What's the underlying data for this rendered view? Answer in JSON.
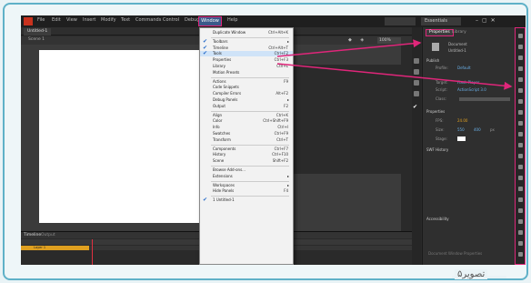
{
  "caption": "تصویر۵",
  "menubar": {
    "items": [
      "File",
      "Edit",
      "View",
      "Insert",
      "Modify",
      "Text",
      "Commands",
      "Control",
      "Debug",
      "Window",
      "Help"
    ],
    "window_label": "Window",
    "workspace": "Essentials"
  },
  "document": {
    "tab": "Untitled-1",
    "scene": "Scene 1",
    "zoom": "100%"
  },
  "properties": {
    "tab_label": "Properties",
    "tab2_label": "Library",
    "doc_type": "Document",
    "doc_name": "Untitled-1",
    "section_publish": "Publish",
    "profile_label": "Profile:",
    "profile_value": "Default",
    "target_label": "Target:",
    "target_value": "Flash Player",
    "script_label": "Script:",
    "script_value": "ActionScript 3.0",
    "class_label": "Class:",
    "section_properties": "Properties",
    "fps_label": "FPS:",
    "fps_value": "24.00",
    "size_label": "Size:",
    "size_w": "550",
    "size_h": "400",
    "size_unit": "px",
    "stage_label": "Stage:",
    "section_swf": "SWF History",
    "section_accessibility": "Accessibility",
    "footer": "Document Window Properties"
  },
  "timeline": {
    "tab1": "Timeline",
    "tab2": "Output",
    "layer_name": "Layer 1"
  },
  "window_menu": {
    "items": [
      {
        "label": "Duplicate Window",
        "shortcut": "Ctrl+Alt+K",
        "checked": false
      },
      {
        "sep": true
      },
      {
        "label": "Toolbars",
        "shortcut": "",
        "checked": true,
        "submenu": true
      },
      {
        "label": "Timeline",
        "shortcut": "Ctrl+Alt+T",
        "checked": true
      },
      {
        "label": "Tools",
        "shortcut": "Ctrl+F2",
        "checked": true,
        "highlight": true
      },
      {
        "label": "Properties",
        "shortcut": "Ctrl+F3",
        "checked": false
      },
      {
        "label": "Library",
        "shortcut": "Ctrl+L",
        "checked": false
      },
      {
        "label": "Motion Presets",
        "shortcut": "",
        "checked": false
      },
      {
        "sep": true
      },
      {
        "label": "Actions",
        "shortcut": "F9",
        "checked": false
      },
      {
        "label": "Code Snippets",
        "shortcut": "",
        "checked": false
      },
      {
        "label": "Compiler Errors",
        "shortcut": "Alt+F2",
        "checked": false
      },
      {
        "label": "Debug Panels",
        "shortcut": "",
        "checked": false,
        "submenu": true
      },
      {
        "label": "Output",
        "shortcut": "F2",
        "checked": false
      },
      {
        "sep": true
      },
      {
        "label": "Align",
        "shortcut": "Ctrl+K",
        "checked": false
      },
      {
        "label": "Color",
        "shortcut": "Ctrl+Shift+F9",
        "checked": false
      },
      {
        "label": "Info",
        "shortcut": "Ctrl+I",
        "checked": false
      },
      {
        "label": "Swatches",
        "shortcut": "Ctrl+F9",
        "checked": false
      },
      {
        "label": "Transform",
        "shortcut": "Ctrl+T",
        "checked": false
      },
      {
        "sep": true
      },
      {
        "label": "Components",
        "shortcut": "Ctrl+F7",
        "checked": false
      },
      {
        "label": "History",
        "shortcut": "Ctrl+F10",
        "checked": false
      },
      {
        "label": "Scene",
        "shortcut": "Shift+F2",
        "checked": false
      },
      {
        "sep": true
      },
      {
        "label": "Browse Add-ons...",
        "shortcut": "",
        "checked": false
      },
      {
        "label": "Extensions",
        "shortcut": "",
        "checked": false,
        "submenu": true
      },
      {
        "sep": true
      },
      {
        "label": "Workspaces",
        "shortcut": "",
        "checked": false,
        "submenu": true
      },
      {
        "label": "Hide Panels",
        "shortcut": "F4",
        "checked": false
      },
      {
        "sep": true
      },
      {
        "label": "1 Untitled-1",
        "shortcut": "",
        "checked": true
      }
    ]
  },
  "colors": {
    "highlight": "#e0267a",
    "frame": "#5fb1c8"
  }
}
